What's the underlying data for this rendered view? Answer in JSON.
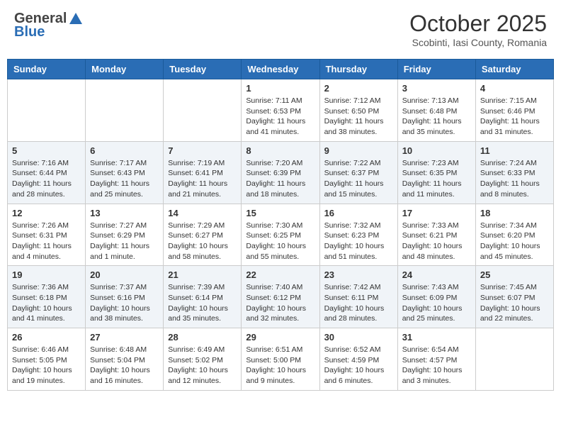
{
  "header": {
    "logo_general": "General",
    "logo_blue": "Blue",
    "month_title": "October 2025",
    "subtitle": "Scobinti, Iasi County, Romania"
  },
  "days_of_week": [
    "Sunday",
    "Monday",
    "Tuesday",
    "Wednesday",
    "Thursday",
    "Friday",
    "Saturday"
  ],
  "weeks": [
    [
      {
        "day": "",
        "info": ""
      },
      {
        "day": "",
        "info": ""
      },
      {
        "day": "",
        "info": ""
      },
      {
        "day": "1",
        "info": "Sunrise: 7:11 AM\nSunset: 6:53 PM\nDaylight: 11 hours and 41 minutes."
      },
      {
        "day": "2",
        "info": "Sunrise: 7:12 AM\nSunset: 6:50 PM\nDaylight: 11 hours and 38 minutes."
      },
      {
        "day": "3",
        "info": "Sunrise: 7:13 AM\nSunset: 6:48 PM\nDaylight: 11 hours and 35 minutes."
      },
      {
        "day": "4",
        "info": "Sunrise: 7:15 AM\nSunset: 6:46 PM\nDaylight: 11 hours and 31 minutes."
      }
    ],
    [
      {
        "day": "5",
        "info": "Sunrise: 7:16 AM\nSunset: 6:44 PM\nDaylight: 11 hours and 28 minutes."
      },
      {
        "day": "6",
        "info": "Sunrise: 7:17 AM\nSunset: 6:43 PM\nDaylight: 11 hours and 25 minutes."
      },
      {
        "day": "7",
        "info": "Sunrise: 7:19 AM\nSunset: 6:41 PM\nDaylight: 11 hours and 21 minutes."
      },
      {
        "day": "8",
        "info": "Sunrise: 7:20 AM\nSunset: 6:39 PM\nDaylight: 11 hours and 18 minutes."
      },
      {
        "day": "9",
        "info": "Sunrise: 7:22 AM\nSunset: 6:37 PM\nDaylight: 11 hours and 15 minutes."
      },
      {
        "day": "10",
        "info": "Sunrise: 7:23 AM\nSunset: 6:35 PM\nDaylight: 11 hours and 11 minutes."
      },
      {
        "day": "11",
        "info": "Sunrise: 7:24 AM\nSunset: 6:33 PM\nDaylight: 11 hours and 8 minutes."
      }
    ],
    [
      {
        "day": "12",
        "info": "Sunrise: 7:26 AM\nSunset: 6:31 PM\nDaylight: 11 hours and 4 minutes."
      },
      {
        "day": "13",
        "info": "Sunrise: 7:27 AM\nSunset: 6:29 PM\nDaylight: 11 hours and 1 minute."
      },
      {
        "day": "14",
        "info": "Sunrise: 7:29 AM\nSunset: 6:27 PM\nDaylight: 10 hours and 58 minutes."
      },
      {
        "day": "15",
        "info": "Sunrise: 7:30 AM\nSunset: 6:25 PM\nDaylight: 10 hours and 55 minutes."
      },
      {
        "day": "16",
        "info": "Sunrise: 7:32 AM\nSunset: 6:23 PM\nDaylight: 10 hours and 51 minutes."
      },
      {
        "day": "17",
        "info": "Sunrise: 7:33 AM\nSunset: 6:21 PM\nDaylight: 10 hours and 48 minutes."
      },
      {
        "day": "18",
        "info": "Sunrise: 7:34 AM\nSunset: 6:20 PM\nDaylight: 10 hours and 45 minutes."
      }
    ],
    [
      {
        "day": "19",
        "info": "Sunrise: 7:36 AM\nSunset: 6:18 PM\nDaylight: 10 hours and 41 minutes."
      },
      {
        "day": "20",
        "info": "Sunrise: 7:37 AM\nSunset: 6:16 PM\nDaylight: 10 hours and 38 minutes."
      },
      {
        "day": "21",
        "info": "Sunrise: 7:39 AM\nSunset: 6:14 PM\nDaylight: 10 hours and 35 minutes."
      },
      {
        "day": "22",
        "info": "Sunrise: 7:40 AM\nSunset: 6:12 PM\nDaylight: 10 hours and 32 minutes."
      },
      {
        "day": "23",
        "info": "Sunrise: 7:42 AM\nSunset: 6:11 PM\nDaylight: 10 hours and 28 minutes."
      },
      {
        "day": "24",
        "info": "Sunrise: 7:43 AM\nSunset: 6:09 PM\nDaylight: 10 hours and 25 minutes."
      },
      {
        "day": "25",
        "info": "Sunrise: 7:45 AM\nSunset: 6:07 PM\nDaylight: 10 hours and 22 minutes."
      }
    ],
    [
      {
        "day": "26",
        "info": "Sunrise: 6:46 AM\nSunset: 5:05 PM\nDaylight: 10 hours and 19 minutes."
      },
      {
        "day": "27",
        "info": "Sunrise: 6:48 AM\nSunset: 5:04 PM\nDaylight: 10 hours and 16 minutes."
      },
      {
        "day": "28",
        "info": "Sunrise: 6:49 AM\nSunset: 5:02 PM\nDaylight: 10 hours and 12 minutes."
      },
      {
        "day": "29",
        "info": "Sunrise: 6:51 AM\nSunset: 5:00 PM\nDaylight: 10 hours and 9 minutes."
      },
      {
        "day": "30",
        "info": "Sunrise: 6:52 AM\nSunset: 4:59 PM\nDaylight: 10 hours and 6 minutes."
      },
      {
        "day": "31",
        "info": "Sunrise: 6:54 AM\nSunset: 4:57 PM\nDaylight: 10 hours and 3 minutes."
      },
      {
        "day": "",
        "info": ""
      }
    ]
  ]
}
